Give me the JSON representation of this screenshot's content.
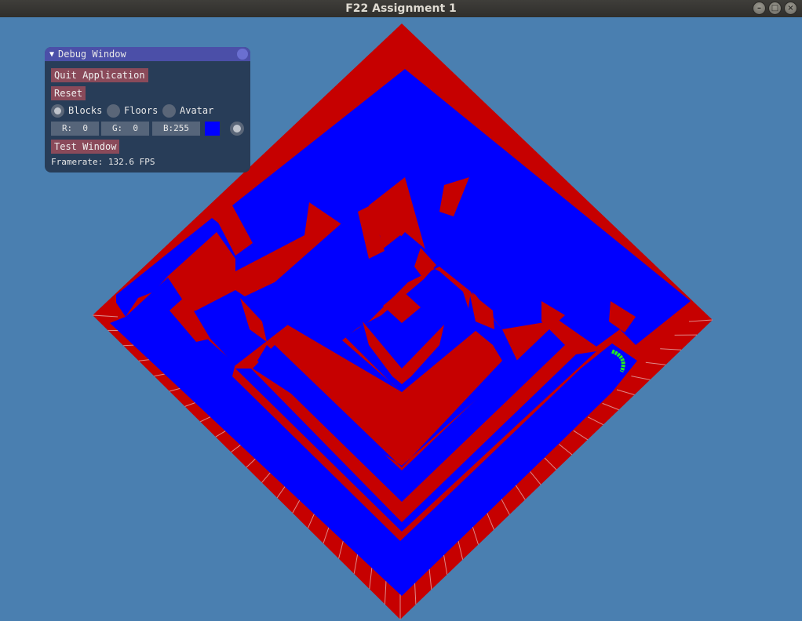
{
  "window": {
    "title": "F22 Assignment 1",
    "buttons": [
      "minimize-icon",
      "maximize-icon",
      "close-icon"
    ]
  },
  "colors": {
    "background": "#4a7fb0",
    "blocks": "#0000ff",
    "floors": "#c00000",
    "avatar": "#22ee22"
  },
  "debug": {
    "title": "Debug Window",
    "quit_label": "Quit Application",
    "reset_label": "Reset",
    "radio": {
      "options": [
        "Blocks",
        "Floors",
        "Avatar"
      ],
      "selected": "Blocks"
    },
    "rgb": {
      "r": "R:  0",
      "g": "G:  0",
      "b": "B:255"
    },
    "swatch_color": "#0000ff",
    "test_window_label": "Test Window",
    "framerate": "Framerate: 132.6 FPS"
  }
}
